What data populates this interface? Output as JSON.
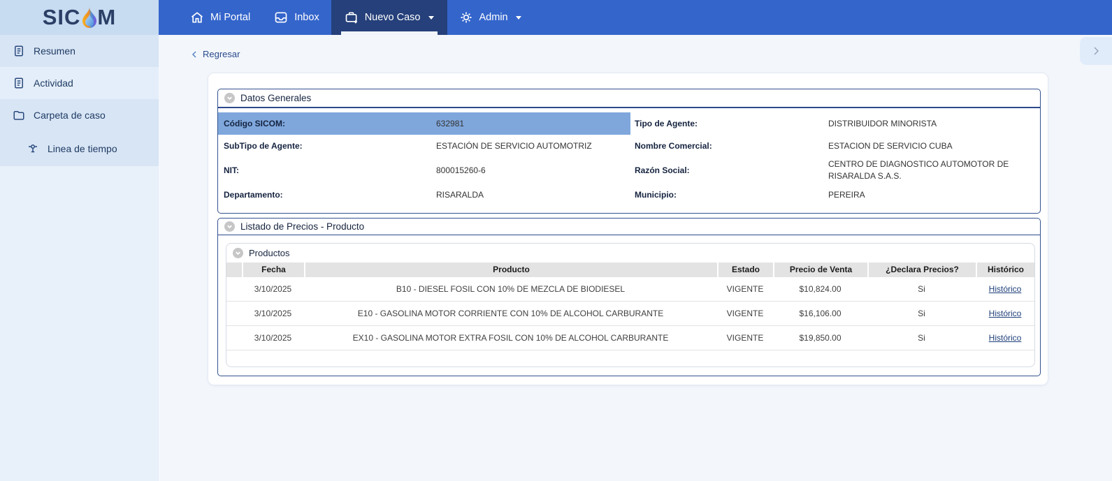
{
  "brand": {
    "name_prefix": "SIC",
    "name_suffix": "M"
  },
  "topnav": {
    "items": [
      {
        "label": "Mi Portal",
        "icon": "home-icon",
        "active": false
      },
      {
        "label": "Inbox",
        "icon": "inbox-icon",
        "active": false
      },
      {
        "label": "Nuevo Caso",
        "icon": "briefcase-plus-icon",
        "active": true,
        "has_caret": true
      },
      {
        "label": "Admin",
        "icon": "gear-icon",
        "active": false,
        "has_caret": true
      }
    ]
  },
  "sidebar": {
    "items": [
      {
        "label": "Resumen",
        "icon": "journal-icon"
      },
      {
        "label": "Actividad",
        "icon": "journal-icon"
      },
      {
        "label": "Carpeta de caso",
        "icon": "folder-icon"
      },
      {
        "label": "Linea de tiempo",
        "icon": "timeline-icon",
        "indent": true
      }
    ]
  },
  "breadcrumb": {
    "back_label": "Regresar"
  },
  "datos_generales": {
    "title": "Datos Generales",
    "fields_left": [
      {
        "label": "Código SICOM:",
        "value": "632981",
        "highlighted": true
      },
      {
        "label": "SubTipo de Agente:",
        "value": "ESTACIÓN DE SERVICIO AUTOMOTRIZ"
      },
      {
        "label": "NIT:",
        "value": "800015260-6"
      },
      {
        "label": "Departamento:",
        "value": "RISARALDA"
      }
    ],
    "fields_right": [
      {
        "label": "Tipo de Agente:",
        "value": "DISTRIBUIDOR MINORISTA"
      },
      {
        "label": "Nombre Comercial:",
        "value": "ESTACION DE SERVICIO CUBA"
      },
      {
        "label": "Razón Social:",
        "value": "CENTRO DE DIAGNOSTICO AUTOMOTOR DE RISARALDA S.A.S."
      },
      {
        "label": "Municipio:",
        "value": "PEREIRA"
      }
    ]
  },
  "listado": {
    "title": "Listado de Precios - Producto",
    "productos": {
      "title": "Productos",
      "columns": [
        "",
        "Fecha",
        "Producto",
        "Estado",
        "Precio de Venta",
        "¿Declara Precios?",
        "Histórico"
      ],
      "rows": [
        {
          "fecha": "3/10/2025",
          "producto": "B10 - DIESEL FOSIL CON 10% DE MEZCLA DE BIODIESEL",
          "estado": "VIGENTE",
          "precio": "$10,824.00",
          "declara": "Si",
          "historico": "Histórico"
        },
        {
          "fecha": "3/10/2025",
          "producto": "E10 - GASOLINA MOTOR CORRIENTE CON 10% DE ALCOHOL CARBURANTE",
          "estado": "VIGENTE",
          "precio": "$16,106.00",
          "declara": "Si",
          "historico": "Histórico"
        },
        {
          "fecha": "3/10/2025",
          "producto": "EX10 - GASOLINA MOTOR EXTRA FOSIL CON 10% DE ALCOHOL CARBURANTE",
          "estado": "VIGENTE",
          "precio": "$19,850.00",
          "declara": "Si",
          "historico": "Histórico"
        }
      ]
    }
  },
  "colors": {
    "nav_blue": "#3465cb",
    "active_tab": "#25407a",
    "sidebar_bg": "#e8f0fa",
    "sidebar_item_shade": "#d8e5f5",
    "logo_bg": "#c7dbf1",
    "highlight_row": "#7fa7dc",
    "panel_border": "#2c4a8c",
    "table_header_bg": "#e3e3e3",
    "link": "#1d3e7a",
    "content_bg": "#f3f7fc"
  }
}
